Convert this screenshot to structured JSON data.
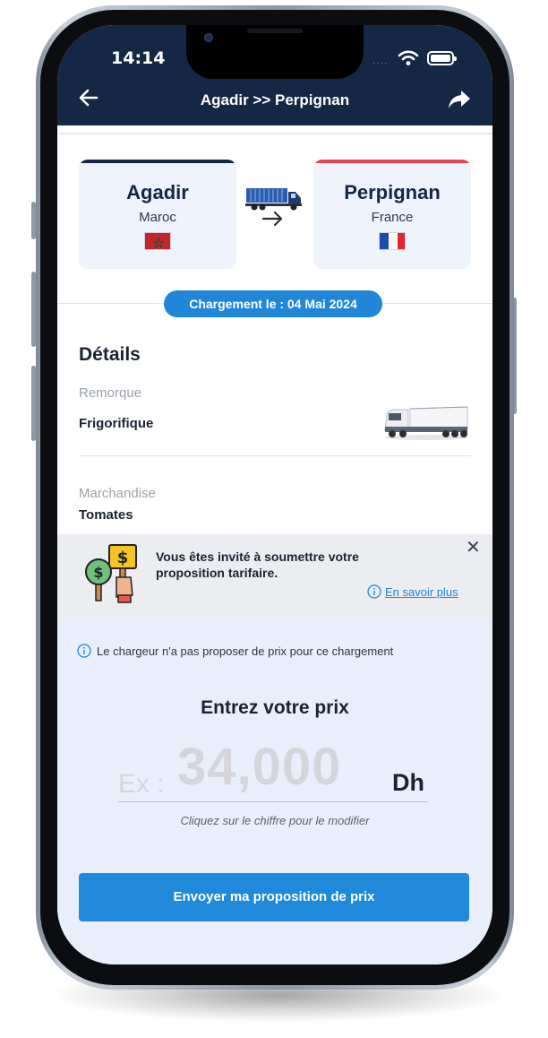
{
  "status_bar": {
    "time": "14:14",
    "dots": "····"
  },
  "app_bar": {
    "title": "Agadir >> Perpignan"
  },
  "route": {
    "origin": {
      "city": "Agadir",
      "country": "Maroc",
      "accent": "#142744"
    },
    "destination": {
      "city": "Perpignan",
      "country": "France",
      "accent": "#e8434b"
    }
  },
  "loading_date_label": "Chargement le : 04 Mai 2024",
  "details": {
    "title": "Détails",
    "trailer_label": "Remorque",
    "trailer_value": "Frigorifique",
    "goods_label": "Marchandise",
    "goods_value": "Tomates"
  },
  "invite_banner": {
    "message": "Vous êtes invité à soumettre votre proposition tarifaire.",
    "learn_more": "En savoir plus",
    "close": "✕"
  },
  "pricing": {
    "info": "Le chargeur n'a pas proposer de prix pour ce chargement",
    "title": "Entrez votre prix",
    "prefix": "Ex :",
    "placeholder_amount": "34,000",
    "currency": "Dh",
    "hint": "Cliquez sur le chiffre pour le modifier",
    "submit_label": "Envoyer ma proposition de prix"
  },
  "colors": {
    "navy": "#142744",
    "primary": "#1f86d8",
    "card_bg": "#eef3fc"
  },
  "icons": [
    "back-arrow-icon",
    "share-icon",
    "truck-icon",
    "arrow-right-icon",
    "morocco-flag-icon",
    "france-flag-icon",
    "reefer-truck-icon",
    "price-signs-icon",
    "close-icon",
    "info-icon"
  ]
}
